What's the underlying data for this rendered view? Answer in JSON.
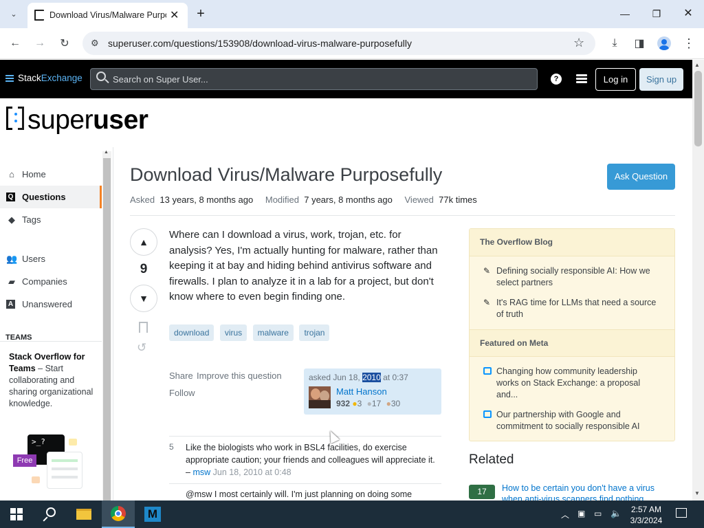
{
  "browser": {
    "tab_title": "Download Virus/Malware Purposefully",
    "url": "superuser.com/questions/153908/download-virus-malware-purposefully"
  },
  "se_header": {
    "logo_stack": "Stack",
    "logo_exchange": "Exchange",
    "search_placeholder": "Search on Super User...",
    "login_label": "Log in",
    "signup_label": "Sign up"
  },
  "site": {
    "logo_super": "super",
    "logo_user": "user"
  },
  "nav": {
    "home": "Home",
    "questions": "Questions",
    "tags": "Tags",
    "users": "Users",
    "companies": "Companies",
    "unanswered": "Unanswered",
    "teams_heading": "TEAMS"
  },
  "teams_promo": {
    "title": "Stack Overflow for Teams",
    "text": " – Start collaborating and sharing organizational knowledge.",
    "free_badge": "Free"
  },
  "question": {
    "title": "Download Virus/Malware Purposefully",
    "ask_button": "Ask Question",
    "asked_label": "Asked",
    "asked_value": "13 years, 8 months ago",
    "modified_label": "Modified",
    "modified_value": "7 years, 8 months ago",
    "viewed_label": "Viewed",
    "viewed_value": "77k times",
    "score": "9",
    "body": "Where can I download a virus, work, trojan, etc. for analysis? Yes, I'm actually hunting for malware, rather than keeping it at bay and hiding behind antivirus software and firewalls. I plan to analyze it in a lab for a project, but don't know where to even begin finding one.",
    "tags": [
      "download",
      "virus",
      "malware",
      "trojan"
    ],
    "share": "Share",
    "improve": "Improve this question",
    "follow": "Follow",
    "asked_line_prefix": "asked Jun 18, ",
    "asked_line_year": "2010",
    "asked_line_suffix": " at 0:37",
    "user_name": "Matt Hanson",
    "user_rep": "932",
    "gold": "3",
    "silver": "17",
    "bronze": "30"
  },
  "comments": [
    {
      "score": "5",
      "text": "Like the biologists who work in BSL4 facilities, do exercise appropriate caution; your friends and colleagues will appreciate it. –",
      "user": "msw",
      "date": "Jun 18, 2010 at 0:48"
    },
    {
      "score": "",
      "text": "@msw I most certainly will. I'm just planning on doing some"
    }
  ],
  "sidebar": {
    "blog_heading": "The Overflow Blog",
    "blog_items": [
      "Defining socially responsible AI: How we select partners",
      "It's RAG time for LLMs that need a source of truth"
    ],
    "meta_heading": "Featured on Meta",
    "meta_items": [
      "Changing how community leadership works on Stack Exchange: a proposal and...",
      "Our partnership with Google and commitment to socially responsible AI"
    ],
    "related_heading": "Related",
    "related": [
      {
        "count": "17",
        "title": "How to be certain you don't have a virus when anti-virus scanners find nothing"
      }
    ]
  },
  "taskbar": {
    "time": "2:57 AM",
    "date": "3/3/2024"
  },
  "colors": {
    "accent": "#f48225",
    "link": "#0074cc",
    "button": "#379ad6"
  }
}
